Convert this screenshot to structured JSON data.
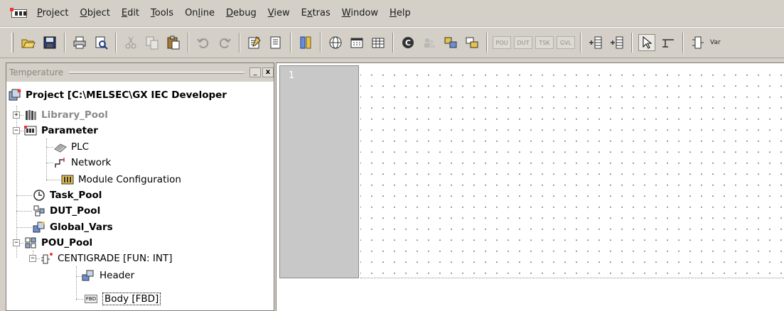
{
  "menubar": {
    "items": [
      {
        "pre": "",
        "ul": "P",
        "post": "roject"
      },
      {
        "pre": "",
        "ul": "O",
        "post": "bject"
      },
      {
        "pre": "",
        "ul": "E",
        "post": "dit"
      },
      {
        "pre": "",
        "ul": "T",
        "post": "ools"
      },
      {
        "pre": "On",
        "ul": "l",
        "post": "ine"
      },
      {
        "pre": "",
        "ul": "D",
        "post": "ebug"
      },
      {
        "pre": "",
        "ul": "V",
        "post": "iew"
      },
      {
        "pre": "E",
        "ul": "x",
        "post": "tras"
      },
      {
        "pre": "",
        "ul": "W",
        "post": "indow"
      },
      {
        "pre": "",
        "ul": "H",
        "post": "elp"
      }
    ]
  },
  "toolbar": {
    "pou_label": "POU",
    "dut_label": "DUT",
    "tsk_label": "TSK",
    "gvl_label": "GVL",
    "var_label": "Var"
  },
  "tree_pane": {
    "title": "Temperature",
    "minimize_label": "_",
    "close_label": "x",
    "root": "Project [C:\\MELSEC\\GX IEC Developer",
    "library_pool": "Library_Pool",
    "parameter": "Parameter",
    "plc": "PLC",
    "network": "Network",
    "module_configuration": "Module Configuration",
    "task_pool": "Task_Pool",
    "dut_pool": "DUT_Pool",
    "global_vars": "Global_Vars",
    "pou_pool": "POU_Pool",
    "centigrade": "CENTIGRADE [FUN: INT]",
    "header": "Header",
    "body": "Body [FBD]",
    "body_icon_text": "FBD"
  },
  "editor": {
    "row_number": "1"
  },
  "colors": {
    "window_bg": "#d4d0c8",
    "gutter": "#c8c8c8",
    "grid_dot": "#8a8a8a"
  }
}
